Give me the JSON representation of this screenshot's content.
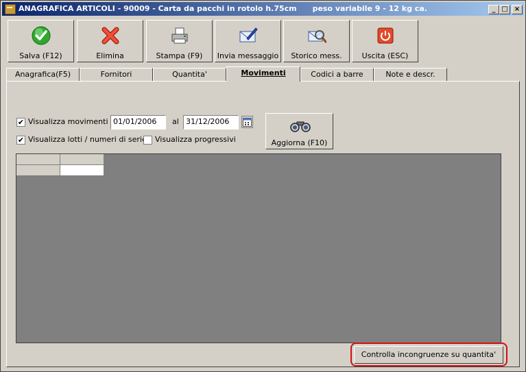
{
  "window": {
    "title": "ANAGRAFICA ARTICOLI - 90009 - Carta da pacchi in rotolo h.75cm      peso variabile 9 - 12 kg ca.",
    "controls": {
      "minimize": "_",
      "maximize": "□",
      "close": "×"
    }
  },
  "toolbar": {
    "save_label": "Salva (F12)",
    "delete_label": "Elimina",
    "print_label": "Stampa (F9)",
    "send_label": "Invia messaggio",
    "history_label": "Storico mess.",
    "exit_label": "Uscita (ESC)"
  },
  "tabs": [
    {
      "label": "Anagrafica(F5)"
    },
    {
      "label": "Fornitori"
    },
    {
      "label": "Quantita'"
    },
    {
      "label": "Movimenti"
    },
    {
      "label": "Codici a barre"
    },
    {
      "label": "Note e descr."
    }
  ],
  "active_tab": "Movimenti",
  "filters": {
    "show_movements": {
      "label": "Visualizza movimenti dal",
      "checked": true,
      "mark": "✔"
    },
    "date_from": "01/01/2006",
    "to_label": "al",
    "date_to": "31/12/2006",
    "show_lots": {
      "label": "Visualizza lotti /  numeri di serie",
      "checked": true,
      "mark": "✔"
    },
    "show_progressive": {
      "label": "Visualizza progressivi",
      "checked": false,
      "mark": ""
    }
  },
  "refresh_button": {
    "label": "Aggiorna (F10)"
  },
  "check_button": {
    "label": "Controlla incongruenze su quantita'"
  },
  "colors": {
    "titlebar_start": "#0a246a",
    "titlebar_end": "#a6caf0",
    "face": "#d4d0c8",
    "grid_background": "#808080",
    "highlight": "#d01010"
  },
  "icons": {
    "save": "check-icon",
    "delete": "x-icon",
    "print": "printer-icon",
    "send": "envelope-pen-icon",
    "history": "magnifier-envelope-icon",
    "exit": "power-icon",
    "calendar": "calendar-icon",
    "refresh": "binoculars-icon"
  }
}
